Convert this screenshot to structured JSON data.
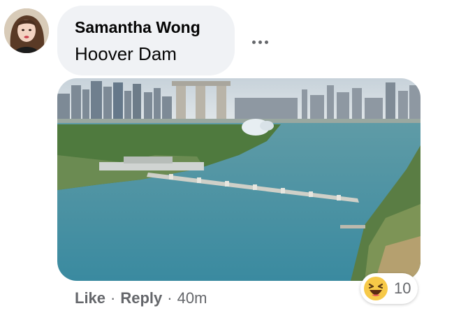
{
  "comment": {
    "author": "Samantha Wong",
    "text": "Hoover Dam",
    "attachment": {
      "type": "photo",
      "subject": "aerial-skyline-and-dam"
    }
  },
  "actions": {
    "like_label": "Like",
    "separator": "·",
    "reply_label": "Reply",
    "timestamp": "40m"
  },
  "reactions": {
    "icon": "laughing-emoji",
    "count": "10"
  },
  "colors": {
    "bubble_bg": "#f0f2f5",
    "secondary_text": "#65676b",
    "water": "#3f8fa0"
  }
}
